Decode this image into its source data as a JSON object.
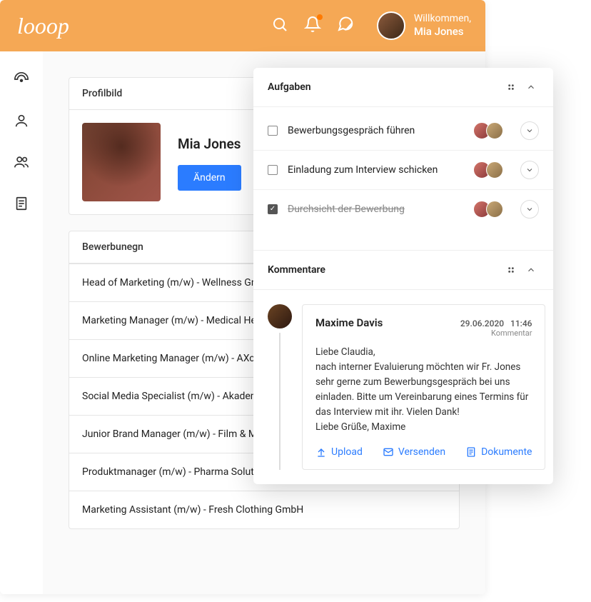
{
  "header": {
    "logo": "looop",
    "welcome_label": "Willkommen,",
    "user_name": "Mia Jones"
  },
  "profile": {
    "header": "Profilbild",
    "name": "Mia Jones",
    "change_button": "Ändern"
  },
  "applications": {
    "header": "Bewerbunegn",
    "rows": [
      "Head of Marketing (m/w) - Wellness GmbH",
      "Marketing Manager (m/w) - Medical Health",
      "Online Marketing Manager (m/w) - AXcom",
      "Social Media Specialist (m/w) - Akademie",
      "Junior Brand Manager (m/w) - Film & Media",
      "Produktmanager (m/w) - Pharma Solutions",
      "Marketing Assistant (m/w) - Fresh Clothing GmbH"
    ]
  },
  "tasks": {
    "header": "Aufgaben",
    "items": [
      {
        "label": "Bewerbungsgespräch führen",
        "done": false
      },
      {
        "label": "Einladung zum Interview schicken",
        "done": false
      },
      {
        "label": "Durchsicht der Bewerbung",
        "done": true
      }
    ]
  },
  "comments": {
    "header": "Kommentare",
    "item": {
      "author": "Maxime Davis",
      "date": "29.06.2020",
      "time": "11:46",
      "type": "Kommentar",
      "body": "Liebe Claudia,\nnach interner Evaluierung möchten wir Fr. Jones sehr gerne zum Bewerbungsgespräch bei uns einladen. Bitte um Vereinbarung eines Termins für das Interview mit ihr. Vielen Dank!\nLiebe Grüße, Maxime",
      "actions": {
        "upload": "Upload",
        "send": "Versenden",
        "documents": "Dokumente"
      }
    }
  }
}
